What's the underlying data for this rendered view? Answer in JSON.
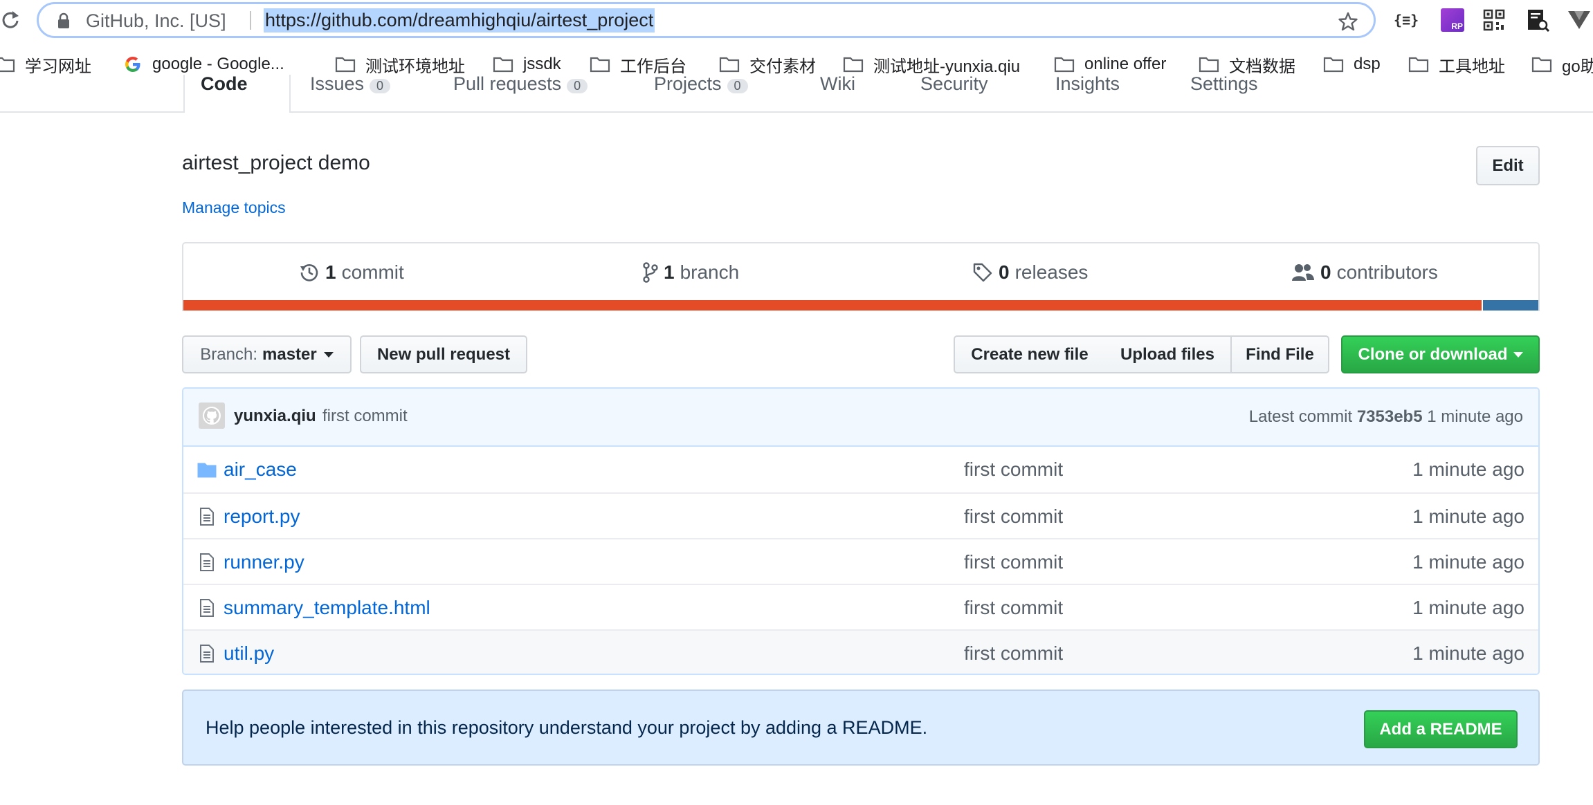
{
  "browser": {
    "site_identity": "GitHub, Inc. [US]",
    "url": "https://github.com/dreamhighqiu/airtest_project",
    "extensions": {
      "json_label": "{≡}",
      "rp_label": "RP"
    }
  },
  "bookmarks": [
    {
      "label": "学习网址",
      "icon": "folder-icon"
    },
    {
      "label": "google - Google...",
      "icon": "google-icon"
    },
    {
      "label": "测试环境地址",
      "icon": "folder-icon"
    },
    {
      "label": "jssdk",
      "icon": "folder-icon"
    },
    {
      "label": "工作后台",
      "icon": "folder-icon"
    },
    {
      "label": "交付素材",
      "icon": "folder-icon"
    },
    {
      "label": "测试地址-yunxia.qiu",
      "icon": "folder-icon"
    },
    {
      "label": "online offer",
      "icon": "folder-icon"
    },
    {
      "label": "文档数据",
      "icon": "folder-icon"
    },
    {
      "label": "dsp",
      "icon": "folder-icon"
    },
    {
      "label": "工具地址",
      "icon": "folder-icon"
    },
    {
      "label": "go助",
      "icon": "folder-icon"
    }
  ],
  "repo_nav": {
    "tabs": [
      {
        "label": "Code"
      },
      {
        "label": "Issues",
        "count": "0"
      },
      {
        "label": "Pull requests",
        "count": "0"
      },
      {
        "label": "Projects",
        "count": "0"
      },
      {
        "label": "Wiki"
      },
      {
        "label": "Security"
      },
      {
        "label": "Insights"
      },
      {
        "label": "Settings"
      }
    ]
  },
  "repo": {
    "description": "airtest_project demo",
    "manage_topics": "Manage topics",
    "edit_label": "Edit"
  },
  "summary": {
    "commits": {
      "num": "1",
      "label": "commit"
    },
    "branches": {
      "num": "1",
      "label": "branch"
    },
    "releases": {
      "num": "0",
      "label": "releases"
    },
    "contributors": {
      "num": "0",
      "label": "contributors"
    },
    "languages": [
      {
        "color": "#e34c26",
        "share": 0.958
      },
      {
        "color": "#3572a5",
        "share": 0.042
      }
    ]
  },
  "file_nav": {
    "branch_prefix": "Branch:",
    "branch_name": "master",
    "new_pr": "New pull request",
    "create_file": "Create new file",
    "upload_files": "Upload files",
    "find_file": "Find File",
    "clone": "Clone or download"
  },
  "commit_tease": {
    "author": "yunxia.qiu",
    "message": "first commit",
    "latest_label": "Latest commit",
    "sha": "7353eb5",
    "age": "1 minute ago"
  },
  "files": [
    {
      "name": "air_case",
      "type": "directory",
      "message": "first commit",
      "age": "1 minute ago"
    },
    {
      "name": "report.py",
      "type": "file",
      "message": "first commit",
      "age": "1 minute ago"
    },
    {
      "name": "runner.py",
      "type": "file",
      "message": "first commit",
      "age": "1 minute ago"
    },
    {
      "name": "summary_template.html",
      "type": "file",
      "message": "first commit",
      "age": "1 minute ago"
    },
    {
      "name": "util.py",
      "type": "file",
      "message": "first commit",
      "age": "1 minute ago"
    }
  ],
  "readme_prompt": {
    "text": "Help people interested in this repository understand your project by adding a README.",
    "button": "Add a README"
  },
  "colors": {
    "link": "#0366d6",
    "primary_button": "#28a745",
    "url_highlight": "#b4d5fe"
  }
}
